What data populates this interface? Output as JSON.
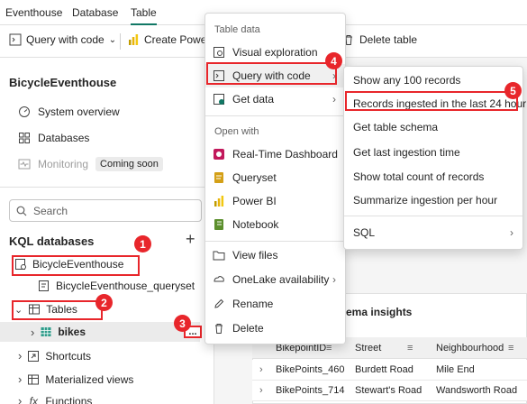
{
  "topnav": {
    "tabs": [
      "Eventhouse",
      "Database",
      "Table"
    ],
    "active": "Table"
  },
  "toolbar": {
    "query_with_code": "Query with code",
    "create_power": "Create Power",
    "delete_table": "Delete table"
  },
  "left": {
    "title": "BicycleEventhouse",
    "nav": [
      "System overview",
      "Databases",
      "Monitoring"
    ],
    "monitoring_badge": "Coming soon",
    "search_placeholder": "Search",
    "kql_title": "KQL databases",
    "tree": {
      "db": "BicycleEventhouse",
      "queryset": "BicycleEventhouse_queryset",
      "tables": "Tables",
      "bikes": "bikes",
      "shortcuts": "Shortcuts",
      "materialized": "Materialized views",
      "functions": "Functions"
    }
  },
  "menu": {
    "header_table_data": "Table data",
    "visual_exploration": "Visual exploration",
    "query_with_code": "Query with code",
    "get_data": "Get data",
    "header_open_with": "Open with",
    "rtd": "Real-Time Dashboard",
    "queryset": "Queryset",
    "powerbi": "Power BI",
    "notebook": "Notebook",
    "view_files": "View files",
    "onelake": "OneLake availability",
    "rename": "Rename",
    "delete": "Delete"
  },
  "submenu": [
    "Show any 100 records",
    "Records ingested in the last 24 hour",
    "Get table schema",
    "Get last ingestion time",
    "Show total count of records",
    "Summarize ingestion per hour",
    "SQL"
  ],
  "steps": [
    "1",
    "2",
    "3",
    "4",
    "5"
  ],
  "panel": {
    "title": "chema insights",
    "columns": [
      "BikepointID",
      "Street",
      "Neighbourhood"
    ],
    "rows": [
      [
        "BikePoints_460",
        "Burdett Road",
        "Mile End"
      ],
      [
        "BikePoints_714",
        "Stewart's Road",
        "Wandsworth Road"
      ]
    ]
  },
  "more_icon": "...",
  "colors": {
    "accent": "#117865",
    "highlight": "#e8262b"
  }
}
